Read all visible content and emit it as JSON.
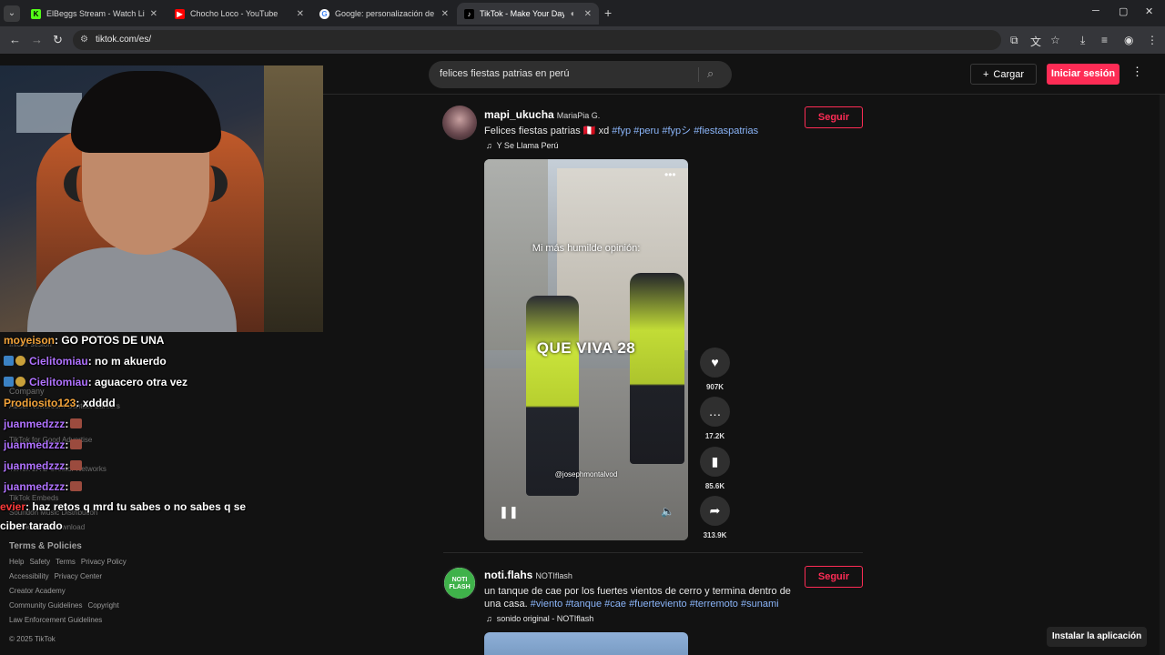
{
  "browser": {
    "tabs": [
      {
        "label": "ElBeggs Stream - Watch Live on",
        "icon": "kick-icon",
        "color": "#53fc18"
      },
      {
        "label": "Chocho Loco - YouTube",
        "icon": "youtube-icon",
        "color": "#ff0000"
      },
      {
        "label": "Google: personalización de la b",
        "icon": "google-icon",
        "color": "#4285f4"
      },
      {
        "label": "TikTok - Make Your Day",
        "icon": "tiktok-icon",
        "color": "#000000"
      }
    ],
    "url": "tiktok.com/es/"
  },
  "header": {
    "search_query": "felices fiestas patrias en perú",
    "upload_label": "Cargar",
    "login_label": "Iniciar sesión"
  },
  "sidebar": {
    "faint": [
      "Iniciar sesión",
      "Company",
      "About Newsroom Contact Careers",
      "TikTok for Good  Advertise",
      "TikTok LIVE Creator Networks",
      "TikTok Embeds",
      "Soundon Music Distribution",
      "TikTok Video Download"
    ],
    "terms_title": "Terms & Policies",
    "row1": [
      "Help",
      "Safety",
      "Terms",
      "Privacy Policy"
    ],
    "row2": [
      "Accessibility",
      "Privacy Center"
    ],
    "row3": [
      "Creator Academy"
    ],
    "row4": [
      "Community Guidelines",
      "Copyright"
    ],
    "row5": [
      "Law Enforcement Guidelines"
    ],
    "copyright": "© 2025 TikTok"
  },
  "chat": [
    {
      "user": "moyeison",
      "color": "#f2a33a",
      "text": ": GO POTOS DE UNA"
    },
    {
      "user": "Cielitomiau",
      "color": "#b072ff",
      "text": ": no m akuerdo"
    },
    {
      "user": "Cielitomiau",
      "color": "#b072ff",
      "text": ": aguacero otra vez"
    },
    {
      "user": "Prodiosito123",
      "color": "#f2a33a",
      "text": ": xdddd"
    },
    {
      "user": "juanmedzzz",
      "color": "#b072ff",
      "text": ":"
    },
    {
      "user": "juanmedzzz",
      "color": "#b072ff",
      "text": ":"
    },
    {
      "user": "juanmedzzz",
      "color": "#b072ff",
      "text": ":"
    },
    {
      "user": "juanmedzzz",
      "color": "#b072ff",
      "text": ":"
    },
    {
      "user": "evier",
      "color": "#ff3b3b",
      "text": ": haz retos q mrd tu sabes o no sabes q se"
    },
    {
      "user": "",
      "color": "#ffffff",
      "text": "ciber tarado"
    }
  ],
  "post1": {
    "username": "mapi_ukucha",
    "nickname": "MariaPia G.",
    "caption_text": "Felices fiestas patrias 🇵🇪 xd",
    "hashtags": [
      "#fyp",
      "#peru",
      "#fypシ",
      "#fiestaspatrias"
    ],
    "music": "Y Se Llama Perú",
    "follow_label": "Seguir",
    "video_text_top": "Mi más humilde opinión:",
    "video_text_mid": "QUE VIVA 28",
    "video_handle": "@josephmontalvod",
    "actions": [
      {
        "icon": "heart-icon",
        "count": "907K"
      },
      {
        "icon": "comment-icon",
        "count": "17.2K"
      },
      {
        "icon": "bookmark-icon",
        "count": "85.6K"
      },
      {
        "icon": "share-icon",
        "count": "313.9K"
      }
    ]
  },
  "post2": {
    "username": "noti.flahs",
    "nickname": "NOTIflash",
    "caption_line1": "un tanque de cae por los fuertes vientos de cerro y termina dentro de",
    "caption_line2_prefix": "una casa.",
    "hashtags": [
      "#viento",
      "#tanque",
      "#cae",
      "#fuerteviento",
      "#terremoto",
      "#sunami"
    ],
    "music": "sonido original - NOTIflash",
    "follow_label": "Seguir",
    "avatar_text": "NOTI FLASH"
  },
  "install_label": "Instalar la aplicación"
}
